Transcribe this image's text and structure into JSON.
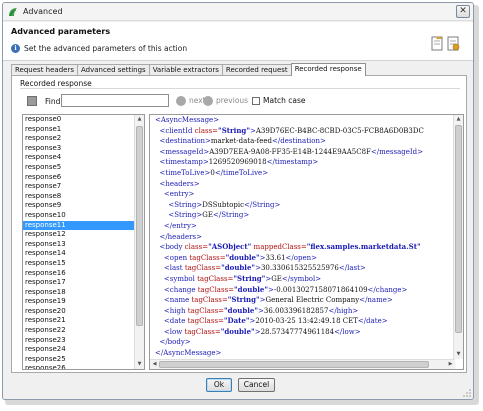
{
  "window": {
    "title": "Advanced"
  },
  "header": {
    "title": "Advanced parameters",
    "description": "Set the advanced parameters of this action"
  },
  "tabs": [
    {
      "label": "Request headers",
      "active": false
    },
    {
      "label": "Advanced settings",
      "active": false
    },
    {
      "label": "Variable extractors",
      "active": false
    },
    {
      "label": "Recorded request",
      "active": false
    },
    {
      "label": "Recorded response",
      "active": true
    }
  ],
  "recorded_response": {
    "section_label": "Recorded response",
    "find_label": "Find:",
    "find_value": "",
    "next_label": "next",
    "previous_label": "previous",
    "match_case_label": "Match case",
    "match_case_checked": false
  },
  "responses": {
    "selected": "response11",
    "items": [
      "response0",
      "response1",
      "response2",
      "response3",
      "response4",
      "response5",
      "response6",
      "response7",
      "response8",
      "response9",
      "response10",
      "response11",
      "response12",
      "response13",
      "response14",
      "response15",
      "response16",
      "response17",
      "response18",
      "response19",
      "response20",
      "response21",
      "response22",
      "response23",
      "response24",
      "response25",
      "response26"
    ]
  },
  "xml_lines": [
    {
      "i": 0,
      "open": "<AsyncMessage>",
      "text": "",
      "close": ""
    },
    {
      "i": 1,
      "open": "<clientId",
      "attrs": [
        [
          "class",
          "String"
        ]
      ],
      "text": "A39D76EC-B4BC-8CBD-03C5-FCB8A6D0B3DC",
      "close": ""
    },
    {
      "i": 1,
      "open": "<destination>",
      "text": "market-data-feed",
      "close": "</destination>"
    },
    {
      "i": 1,
      "open": "<messageId>",
      "text": "A39D7EEA-9A08-FF35-E14B-1244E9AA5C8F",
      "close": "</messageId>"
    },
    {
      "i": 1,
      "open": "<timestamp>",
      "text": "1269520969018",
      "close": "</timestamp>"
    },
    {
      "i": 1,
      "open": "<timeToLive>",
      "text": "0",
      "close": "</timeToLive>"
    },
    {
      "i": 1,
      "open": "<headers>",
      "text": "",
      "close": ""
    },
    {
      "i": 2,
      "open": "<entry>",
      "text": "",
      "close": ""
    },
    {
      "i": 3,
      "open": "<String>",
      "text": "DSSubtopic",
      "close": "</String>"
    },
    {
      "i": 3,
      "open": "<String>",
      "text": "GE",
      "close": "</String>"
    },
    {
      "i": 2,
      "open": "</entry>",
      "text": "",
      "close": ""
    },
    {
      "i": 1,
      "open": "</headers>",
      "text": "",
      "close": ""
    },
    {
      "i": 1,
      "open": "<body",
      "attrs": [
        [
          "class",
          "ASObject"
        ],
        [
          "mappedClass",
          "flex.samples.marketdata.St"
        ]
      ],
      "text": "",
      "close": "",
      "noclose": true
    },
    {
      "i": 2,
      "open": "<open",
      "attrs": [
        [
          "tagClass",
          "double"
        ]
      ],
      "text": "33.61",
      "close": "</open>"
    },
    {
      "i": 2,
      "open": "<last",
      "attrs": [
        [
          "tagClass",
          "double"
        ]
      ],
      "text": "30.330615325525976",
      "close": "</last>"
    },
    {
      "i": 2,
      "open": "<symbol",
      "attrs": [
        [
          "tagClass",
          "String"
        ]
      ],
      "text": "GE",
      "close": "</symbol>"
    },
    {
      "i": 2,
      "open": "<change",
      "attrs": [
        [
          "tagClass",
          "double"
        ]
      ],
      "text": "-0.0013027158071864109",
      "close": "</change>"
    },
    {
      "i": 2,
      "open": "<name",
      "attrs": [
        [
          "tagClass",
          "String"
        ]
      ],
      "text": "General Electric Company",
      "close": "</name>"
    },
    {
      "i": 2,
      "open": "<high",
      "attrs": [
        [
          "tagClass",
          "double"
        ]
      ],
      "text": "36.003396182857",
      "close": "</high>"
    },
    {
      "i": 2,
      "open": "<date",
      "attrs": [
        [
          "tagClass",
          "Date"
        ]
      ],
      "text": "2010-03-25 13:42:49.18 CET",
      "close": "</date>"
    },
    {
      "i": 2,
      "open": "<low",
      "attrs": [
        [
          "tagClass",
          "double"
        ]
      ],
      "text": "28.57347774961184",
      "close": "</low>"
    },
    {
      "i": 1,
      "open": "</body>",
      "text": "",
      "close": ""
    },
    {
      "i": 0,
      "open": "</AsyncMessage>",
      "text": "",
      "close": ""
    }
  ],
  "buttons": {
    "ok": "Ok",
    "cancel": "Cancel"
  },
  "colors": {
    "selection": "#3399ff",
    "xml_tag": "#1a1ab5",
    "xml_attr": "#b01010",
    "xml_value": "#1a1ab5"
  }
}
